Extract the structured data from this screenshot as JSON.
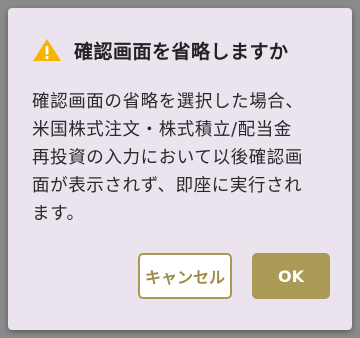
{
  "dialog": {
    "title": "確認画面を省略しますか",
    "icon": "warning-icon",
    "message": "確認画面の省略を選択した場合、\n米国株式注文・株式積立/配当金\n再投資の入力において以後確認画\n面が表示されず、即座に実行され\nます。",
    "cancel_label": "キャンセル",
    "ok_label": "OK"
  },
  "colors": {
    "dialog_background": "#ebe3ed",
    "accent": "#ab9a56",
    "warning": "#f5b400"
  }
}
